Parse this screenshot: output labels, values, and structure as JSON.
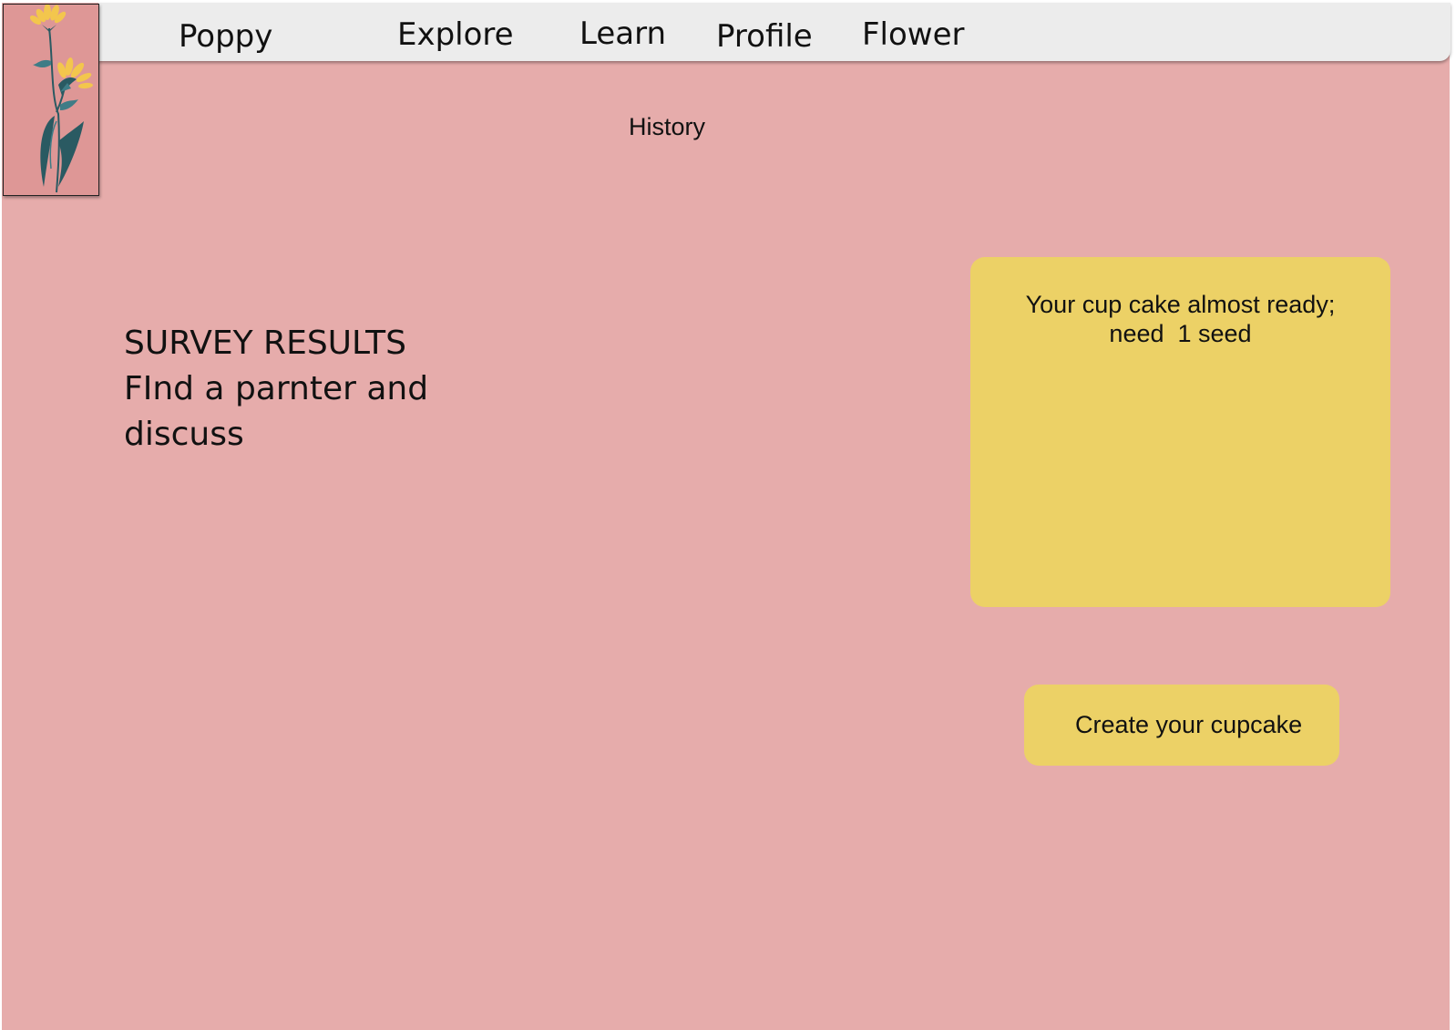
{
  "nav": {
    "brand": "Poppy",
    "items": [
      {
        "label": "Explore"
      },
      {
        "label": "Learn"
      },
      {
        "label": "Profile"
      },
      {
        "label": "Flower"
      }
    ]
  },
  "logo": {
    "icon": "flower-illustration-icon",
    "background_color": "#de9796",
    "petal_color": "#f3c64d",
    "leaf_color": "#2a5a62"
  },
  "main": {
    "subtitle": "History",
    "survey": {
      "line1": "SURVEY RESULTS",
      "line2": "FInd a parnter and",
      "line3": "discuss"
    },
    "status_card": {
      "line1": "Your cup cake almost ready;",
      "line2": "need  1 seed"
    },
    "cta_label": "Create your cupcake"
  },
  "colors": {
    "page_background": "#e6acab",
    "navbar_background": "#ececec",
    "card_yellow": "#ecd166"
  }
}
